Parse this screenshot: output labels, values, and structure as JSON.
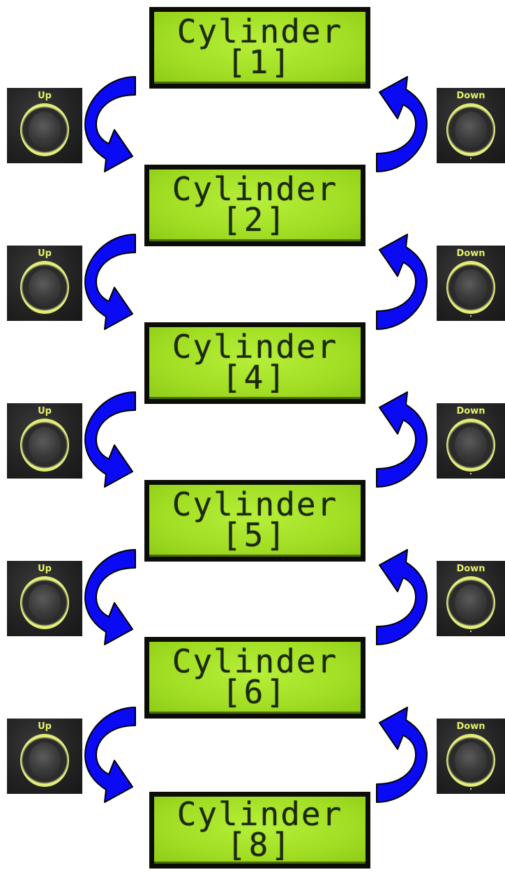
{
  "lcd_displays": [
    {
      "line1": "Cylinder",
      "line2": "[1]"
    },
    {
      "line1": "Cylinder",
      "line2": "[2]"
    },
    {
      "line1": "Cylinder",
      "line2": "[4]"
    },
    {
      "line1": "Cylinder",
      "line2": "[5]"
    },
    {
      "line1": "Cylinder",
      "line2": "[6]"
    },
    {
      "line1": "Cylinder",
      "line2": "[8]"
    }
  ],
  "buttons": {
    "up_label": "Up",
    "down_label": "Down"
  },
  "colors": {
    "arrow_fill": "#0a0af5",
    "arrow_stroke": "#000000",
    "lcd_green": "#a6e22a",
    "lcd_text": "#1c2a0c",
    "button_ring": "#d9e65a"
  }
}
